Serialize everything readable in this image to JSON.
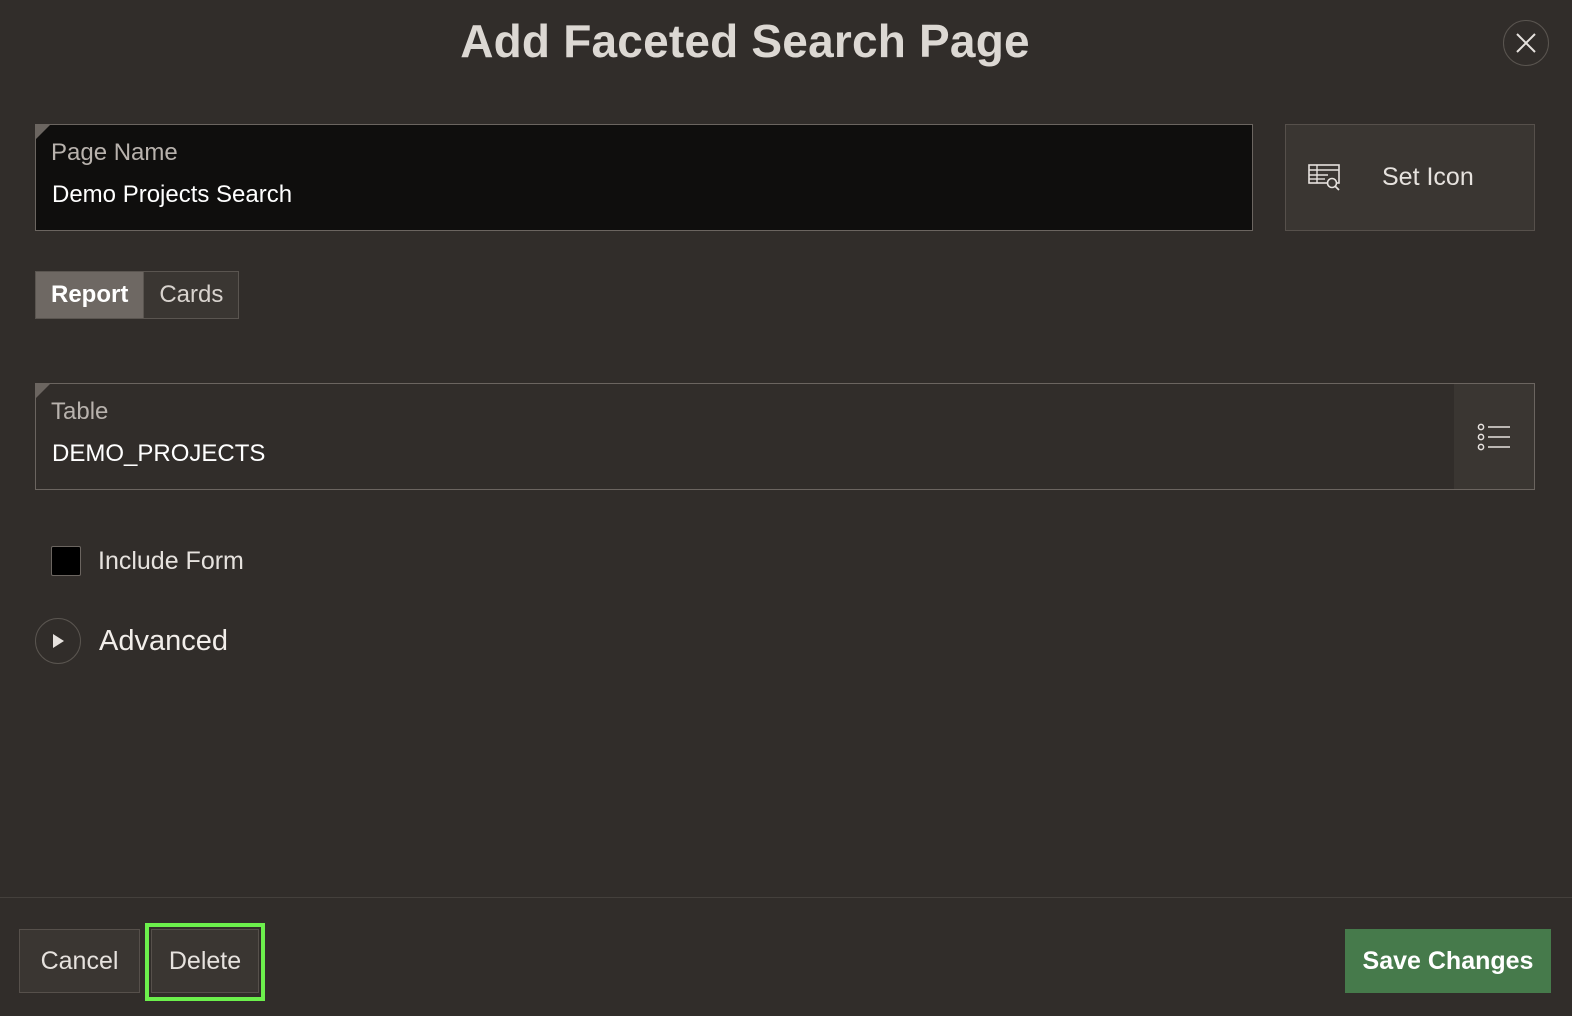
{
  "dialog": {
    "title": "Add Faceted Search Page"
  },
  "page_name": {
    "label": "Page Name",
    "value": "Demo Projects Search"
  },
  "set_icon": {
    "label": "Set Icon",
    "icon": "table-search-icon"
  },
  "layout_toggle": {
    "options": [
      {
        "label": "Report",
        "selected": true
      },
      {
        "label": "Cards",
        "selected": false
      }
    ]
  },
  "table": {
    "label": "Table",
    "value": "DEMO_PROJECTS",
    "lov_icon": "list-icon"
  },
  "include_form": {
    "label": "Include Form",
    "checked": false
  },
  "advanced": {
    "label": "Advanced",
    "expanded": false
  },
  "footer": {
    "cancel_label": "Cancel",
    "delete_label": "Delete",
    "save_label": "Save Changes"
  },
  "colors": {
    "background": "#312d2a",
    "save_button": "#467a4b",
    "highlight": "#6cf04c"
  }
}
